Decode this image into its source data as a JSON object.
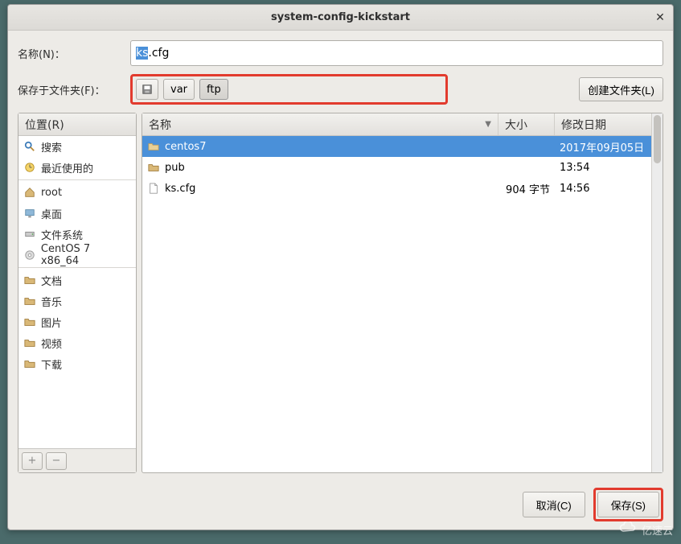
{
  "title": "system-config-kickstart",
  "labels": {
    "name": "名称(N)：",
    "save_in": "保存于文件夹(F)：",
    "create_folder": "创建文件夹(L)",
    "location": "位置(R)",
    "cancel": "取消(C)",
    "save": "保存(S)"
  },
  "filename": {
    "selected": "ks",
    "rest": ".cfg"
  },
  "path": [
    {
      "icon": "floppy-icon",
      "label": ""
    },
    {
      "label": "var"
    },
    {
      "label": "ftp"
    }
  ],
  "sidebar": {
    "items": [
      {
        "icon": "search-icon",
        "label": "搜索"
      },
      {
        "icon": "clock-icon",
        "label": "最近使用的"
      }
    ],
    "items2": [
      {
        "icon": "home-icon",
        "label": "root"
      },
      {
        "icon": "desktop-icon",
        "label": "桌面"
      },
      {
        "icon": "drive-icon",
        "label": "文件系统"
      },
      {
        "icon": "disc-icon",
        "label": "CentOS 7 x86_64"
      }
    ],
    "items3": [
      {
        "icon": "folder-icon",
        "label": "文档"
      },
      {
        "icon": "folder-icon",
        "label": "音乐"
      },
      {
        "icon": "folder-icon",
        "label": "图片"
      },
      {
        "icon": "folder-icon",
        "label": "视频"
      },
      {
        "icon": "folder-icon",
        "label": "下载"
      }
    ]
  },
  "columns": {
    "name": "名称",
    "size": "大小",
    "date": "修改日期"
  },
  "files": [
    {
      "icon": "folder-icon",
      "name": "centos7",
      "size": "",
      "date": "2017年09月05日",
      "selected": true
    },
    {
      "icon": "folder-icon",
      "name": "pub",
      "size": "",
      "date": "13:54",
      "selected": false
    },
    {
      "icon": "file-icon",
      "name": "ks.cfg",
      "size": "904 字节",
      "date": "14:56",
      "selected": false
    }
  ],
  "watermark": "亿速云"
}
